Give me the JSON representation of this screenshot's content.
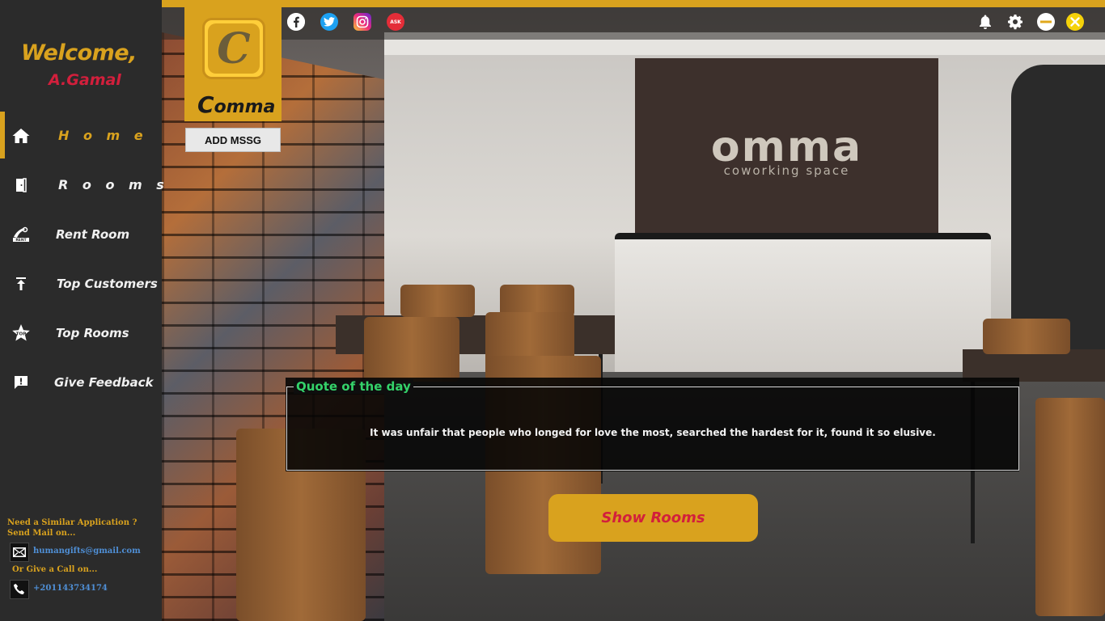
{
  "sidebar": {
    "welcome": "Welcome,",
    "username": "A.Gamal",
    "items": [
      {
        "label": "H o m e",
        "icon": "home-icon",
        "active": true
      },
      {
        "label": "R o o m s",
        "icon": "door-icon",
        "active": false
      },
      {
        "label": "Rent Room",
        "icon": "rent-icon",
        "active": false
      },
      {
        "label": "Top Customers",
        "icon": "arrow-up-icon",
        "active": false
      },
      {
        "label": "Top Rooms",
        "icon": "top-star-icon",
        "active": false
      },
      {
        "label": "Give Feedback",
        "icon": "feedback-icon",
        "active": false
      }
    ],
    "contact": {
      "question_line1": "Need a Similar Application ?",
      "question_line2": "Send Mail on...",
      "email": "humangifts@gmail.com",
      "call_prompt": "Or Give a Call on...",
      "phone": "+201143734174"
    }
  },
  "topbar": {
    "social_icons": [
      "facebook-icon",
      "twitter-icon",
      "instagram-icon",
      "ask-fm-icon"
    ],
    "social_badge_text": "ASK",
    "controls": [
      "bell-icon",
      "gear-icon",
      "minimize-icon",
      "close-icon"
    ]
  },
  "logo": {
    "letter": "C",
    "word_initial": "C",
    "word_rest": "omma"
  },
  "add_message_label": "ADD MSSG",
  "scene": {
    "sign_text": "omma",
    "sign_subtext": "coworking space"
  },
  "quote": {
    "title": "Quote of the day",
    "text": "It was unfair that people who longed for love the most, searched the hardest for it, found it so elusive."
  },
  "show_rooms_label": "Show Rooms",
  "colors": {
    "accent": "#d9a21e",
    "highlight_red": "#d21f3c",
    "quote_title_green": "#34d26a",
    "sidebar_bg": "#2b2b2b",
    "link_blue": "#4f8fd6"
  }
}
